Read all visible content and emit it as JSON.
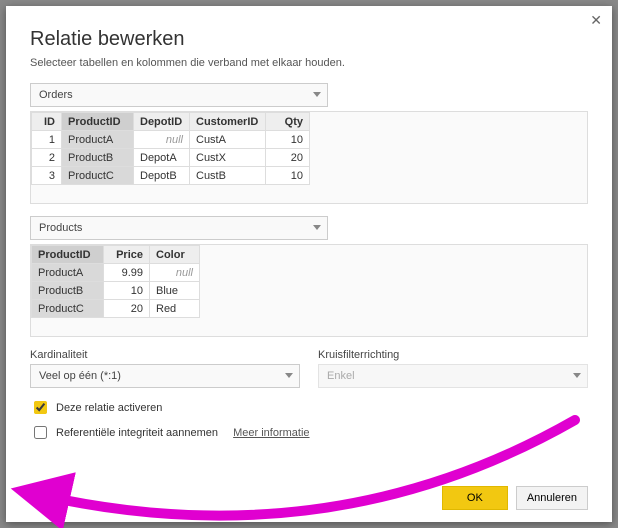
{
  "dialog": {
    "title": "Relatie bewerken",
    "subtitle": "Selecteer tabellen en kolommen die verband met elkaar houden.",
    "close": "✕"
  },
  "table1": {
    "select": "Orders",
    "headers": {
      "id": "ID",
      "pid": "ProductID",
      "dep": "DepotID",
      "cust": "CustomerID",
      "qty": "Qty"
    },
    "rows": [
      {
        "id": "1",
        "pid": "ProductA",
        "dep": "null",
        "cust": "CustA",
        "qty": "10"
      },
      {
        "id": "2",
        "pid": "ProductB",
        "dep": "DepotA",
        "cust": "CustX",
        "qty": "20"
      },
      {
        "id": "3",
        "pid": "ProductC",
        "dep": "DepotB",
        "cust": "CustB",
        "qty": "10"
      }
    ]
  },
  "table2": {
    "select": "Products",
    "headers": {
      "pid": "ProductID",
      "price": "Price",
      "color": "Color"
    },
    "rows": [
      {
        "pid": "ProductA",
        "price": "9.99",
        "color": "null"
      },
      {
        "pid": "ProductB",
        "price": "10",
        "color": "Blue"
      },
      {
        "pid": "ProductC",
        "price": "20",
        "color": "Red"
      }
    ]
  },
  "cardinality": {
    "label": "Kardinaliteit",
    "value": "Veel op één (*:1)"
  },
  "crossfilter": {
    "label": "Kruisfilterrichting",
    "value": "Enkel"
  },
  "checks": {
    "activate": "Deze relatie activeren",
    "referential": "Referentiële integriteit aannemen",
    "more_info": "Meer informatie"
  },
  "buttons": {
    "ok": "OK",
    "cancel": "Annuleren"
  }
}
